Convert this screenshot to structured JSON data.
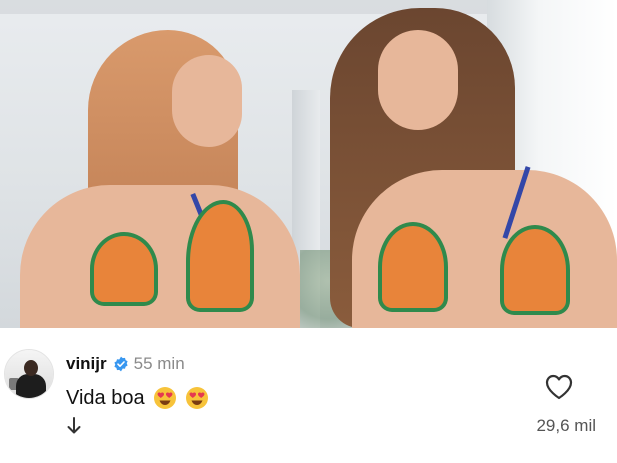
{
  "post": {
    "username": "vinijr",
    "time": "55 min",
    "caption": "Vida boa",
    "likes": "29,6 mil"
  },
  "icons": {
    "verified": "verified-badge-icon",
    "emoji": "heart-eyes-emoji",
    "like": "heart-outline-icon",
    "arrow": "arrow-down-icon"
  },
  "colors": {
    "verified_blue": "#3897f0",
    "emoji_yellow": "#f7c33a",
    "emoji_heart": "#e53950"
  }
}
